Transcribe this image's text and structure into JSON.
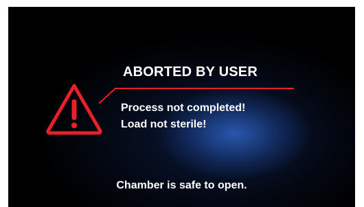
{
  "status": {
    "title": "ABORTED BY USER",
    "messages": [
      "Process not completed!",
      "Load not sterile!"
    ],
    "footer": "Chamber is safe to open."
  },
  "icons": {
    "warning": "warning-triangle-icon"
  },
  "colors": {
    "background": "#000000",
    "accent": "#e8202a",
    "text": "#ffffff",
    "glow": "#2e62c4"
  }
}
